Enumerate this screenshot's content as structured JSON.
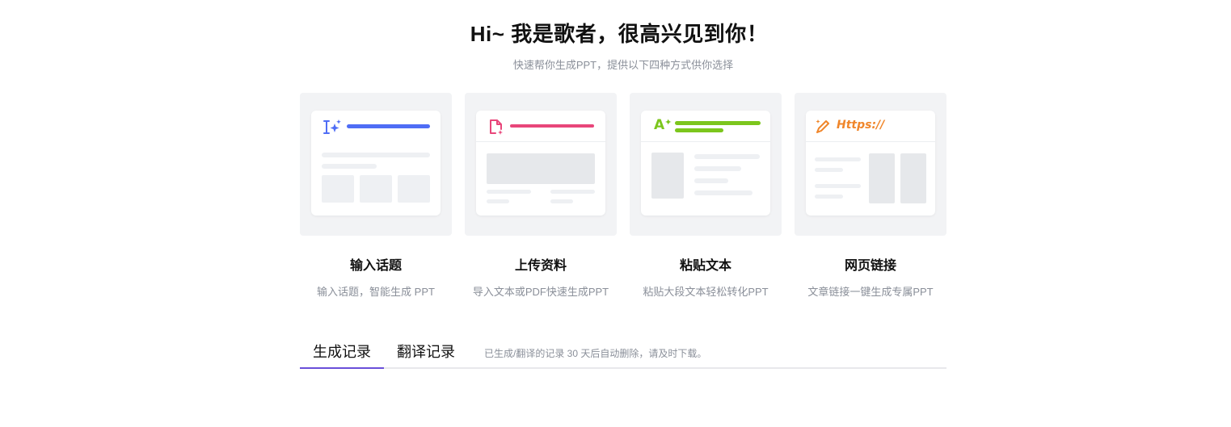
{
  "header": {
    "title": "Hi~ 我是歌者，很高兴见到你！",
    "subtitle": "快速帮你生成PPT，提供以下四种方式供你选择"
  },
  "cards": [
    {
      "name": "输入话题",
      "desc": "输入话题，智能生成 PPT",
      "icon": "ai-text-sparkle-icon",
      "accent": "#4f6df5"
    },
    {
      "name": "上传资料",
      "desc": "导入文本或PDF快速生成PPT",
      "icon": "file-upload-icon",
      "accent": "#e8467a"
    },
    {
      "name": "粘贴文本",
      "desc": "粘贴大段文本轻松转化PPT",
      "icon": "ai-paste-icon",
      "accent": "#7cc61d",
      "icon_text": "A"
    },
    {
      "name": "网页链接",
      "desc": "文章链接一键生成专属PPT",
      "icon": "web-link-icon",
      "accent": "#f0862a",
      "icon_text": "Https://"
    }
  ],
  "tabs": {
    "items": [
      {
        "label": "生成记录",
        "active": true
      },
      {
        "label": "翻译记录",
        "active": false
      }
    ],
    "note": "已生成/翻译的记录 30 天后自动删除，请及时下载。",
    "active_color": "#6a4fd9"
  }
}
